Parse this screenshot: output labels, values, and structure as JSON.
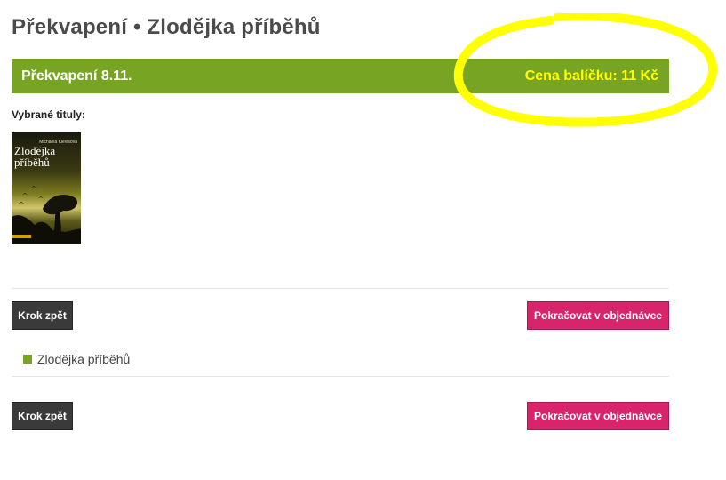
{
  "page": {
    "title": "Překvapení • Zlodějka příběhů"
  },
  "package_bar": {
    "name": "Překvapení 8.11.",
    "price": "Cena balíčku: 11 Kč",
    "colors": {
      "bar": "#77a422",
      "price_text": "#ffff00",
      "highlight": "#ffff00"
    }
  },
  "selected": {
    "label": "Vybrané tituly:",
    "book": {
      "author": "Michaela Klevisová",
      "title": "Zlodějka příběhů"
    }
  },
  "actions": {
    "back_label": "Krok zpět",
    "continue_label": "Pokračovat v objednávce"
  },
  "list": {
    "items": [
      "Zlodějka příběhů"
    ]
  }
}
